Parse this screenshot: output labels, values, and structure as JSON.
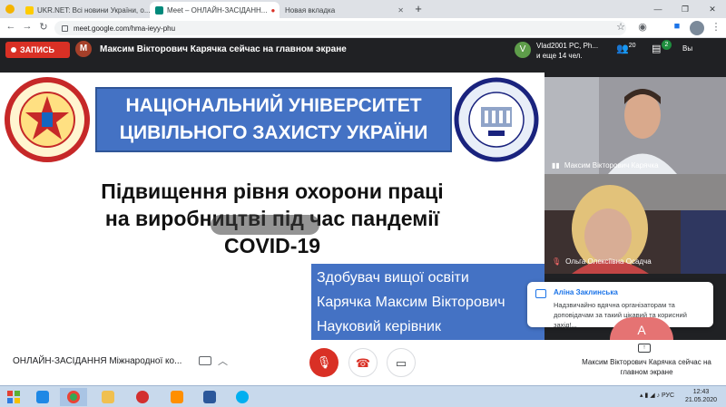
{
  "browser": {
    "tabs": [
      {
        "label": "UKR.NET: Всі новини України, о..."
      },
      {
        "label": "Meet – ОНЛАЙН-ЗАСІДАНН..."
      },
      {
        "label": "Новая вкладка"
      }
    ],
    "new_tab": "+",
    "url": "meet.google.com/hma-ieyy-phu"
  },
  "meet": {
    "recording_label": "ЗАПИСЬ",
    "presenter_initial": "M",
    "presenter_banner": "Максим Вікторович Карячка сейчас на главном экране",
    "participants_initial": "V",
    "participants_line1": "Vlad2001 PC, Ph...",
    "participants_line2": "и еще 14 чел.",
    "people_count": "20",
    "chat_badge": "2",
    "self_label": "Вы",
    "meeting_name": "ОНЛАЙН-ЗАСІДАННЯ Міжнародної ко...",
    "present_status": "Максим Вікторович Карячка сейчас на главном экране"
  },
  "slide": {
    "institution_line1": "НАЦІОНАЛЬНИЙ УНІВЕРСИТЕТ",
    "institution_line2": "ЦИВІЛЬНОГО ЗАХИСТУ УКРАЇНИ",
    "title_line1": "Підвищення рівня охорони праці",
    "title_line2": "на виробництві під час пандемії",
    "title_line3": "COVID-19",
    "author_line1": "Здобувач вищої освіти",
    "author_line2": "Карячка Максим Вікторович",
    "author_line3": "Науковий керівник"
  },
  "participants": [
    {
      "name": "Максим Вікторович Карячка"
    },
    {
      "name": "Ольга Олексіївна Осадча"
    }
  ],
  "toast": {
    "sender": "Аліна Заклинська",
    "message": "Надзвичайно вдячна організаторам та доповідачам за такий цікавий та корисний захід!..."
  },
  "taskbar": {
    "lang": "РУС",
    "time": "12:43",
    "date": "21.05.2020"
  },
  "colors": {
    "record_red": "#d93025",
    "slide_blue": "#4472c4",
    "chat_blue": "#1a73e8",
    "badge_green": "#1e8e3e"
  }
}
